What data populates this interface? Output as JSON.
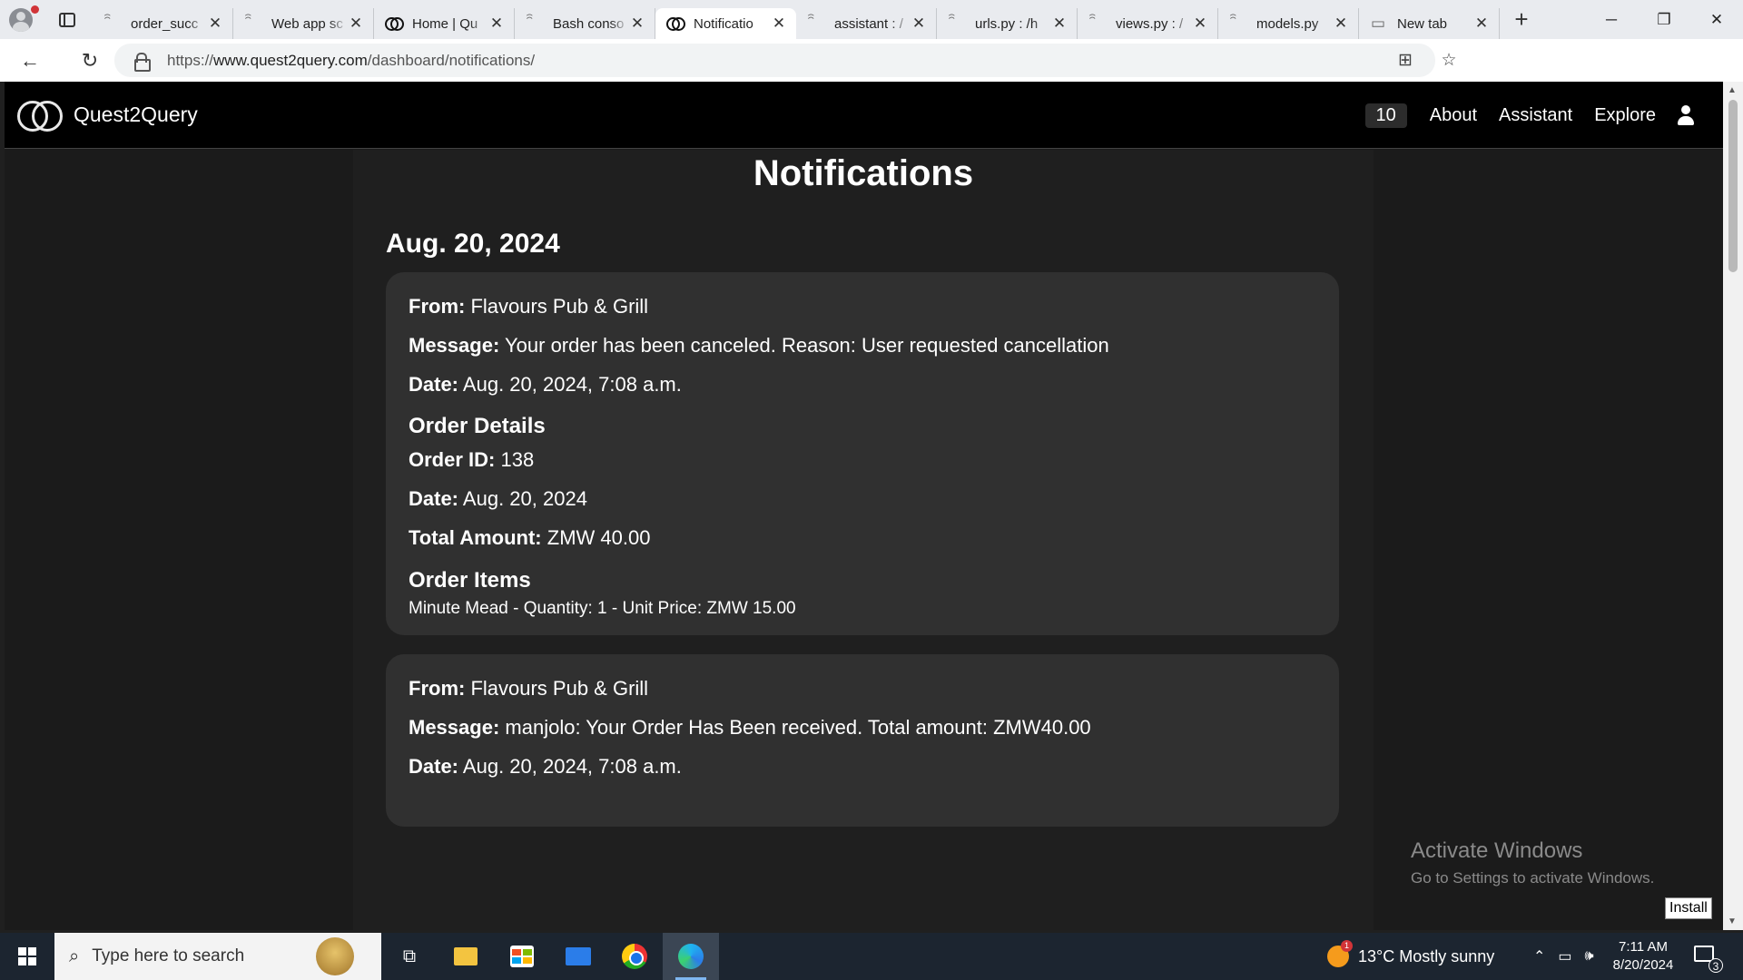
{
  "browser": {
    "tabs": [
      {
        "title": "order_succ",
        "icon": "spiral-icon"
      },
      {
        "title": "Web app sc",
        "icon": "spiral-icon"
      },
      {
        "title": "Home | Qu",
        "icon": "quest2query-icon"
      },
      {
        "title": "Bash conso",
        "icon": "spiral-icon"
      },
      {
        "title": "Notificatio",
        "icon": "quest2query-icon",
        "active": true
      },
      {
        "title": "assistant : /",
        "icon": "spiral-icon"
      },
      {
        "title": "urls.py : /h",
        "icon": "spiral-icon"
      },
      {
        "title": "views.py : /",
        "icon": "spiral-icon"
      },
      {
        "title": "models.py",
        "icon": "spiral-icon"
      },
      {
        "title": "New tab",
        "icon": "newtab-icon"
      }
    ],
    "url_prefix": "https://",
    "url_domain": "www.quest2query.com",
    "url_path": "/dashboard/notifications/"
  },
  "app": {
    "brand": "Quest2Query",
    "badge_count": "10",
    "nav": {
      "about": "About",
      "assistant": "Assistant",
      "explore": "Explore"
    }
  },
  "page": {
    "title": "Notifications",
    "date_group": "Aug. 20, 2024",
    "labels": {
      "from": "From:",
      "message": "Message:",
      "date": "Date:",
      "order_details": "Order Details",
      "order_id": "Order ID:",
      "total_amount": "Total Amount:",
      "order_items": "Order Items"
    },
    "notifications": [
      {
        "from": "Flavours Pub & Grill",
        "message": "Your order has been canceled. Reason: User requested cancellation",
        "date": "Aug. 20, 2024, 7:08 a.m.",
        "order_id": "138",
        "order_date": "Aug. 20, 2024",
        "total_amount": "ZMW 40.00",
        "item": "Minute Mead - Quantity: 1 - Unit Price: ZMW 15.00"
      },
      {
        "from": "Flavours Pub & Grill",
        "message": "manjolo: Your Order Has Been received. Total amount: ZMW40.00",
        "date": "Aug. 20, 2024, 7:08 a.m."
      }
    ]
  },
  "watermark": {
    "line1": "Activate Windows",
    "line2": "Go to Settings to activate Windows."
  },
  "install_label": "Install",
  "taskbar": {
    "search_placeholder": "Type here to search",
    "weather": "13°C  Mostly sunny",
    "time": "7:11 AM",
    "date": "8/20/2024",
    "notification_count": "3"
  }
}
